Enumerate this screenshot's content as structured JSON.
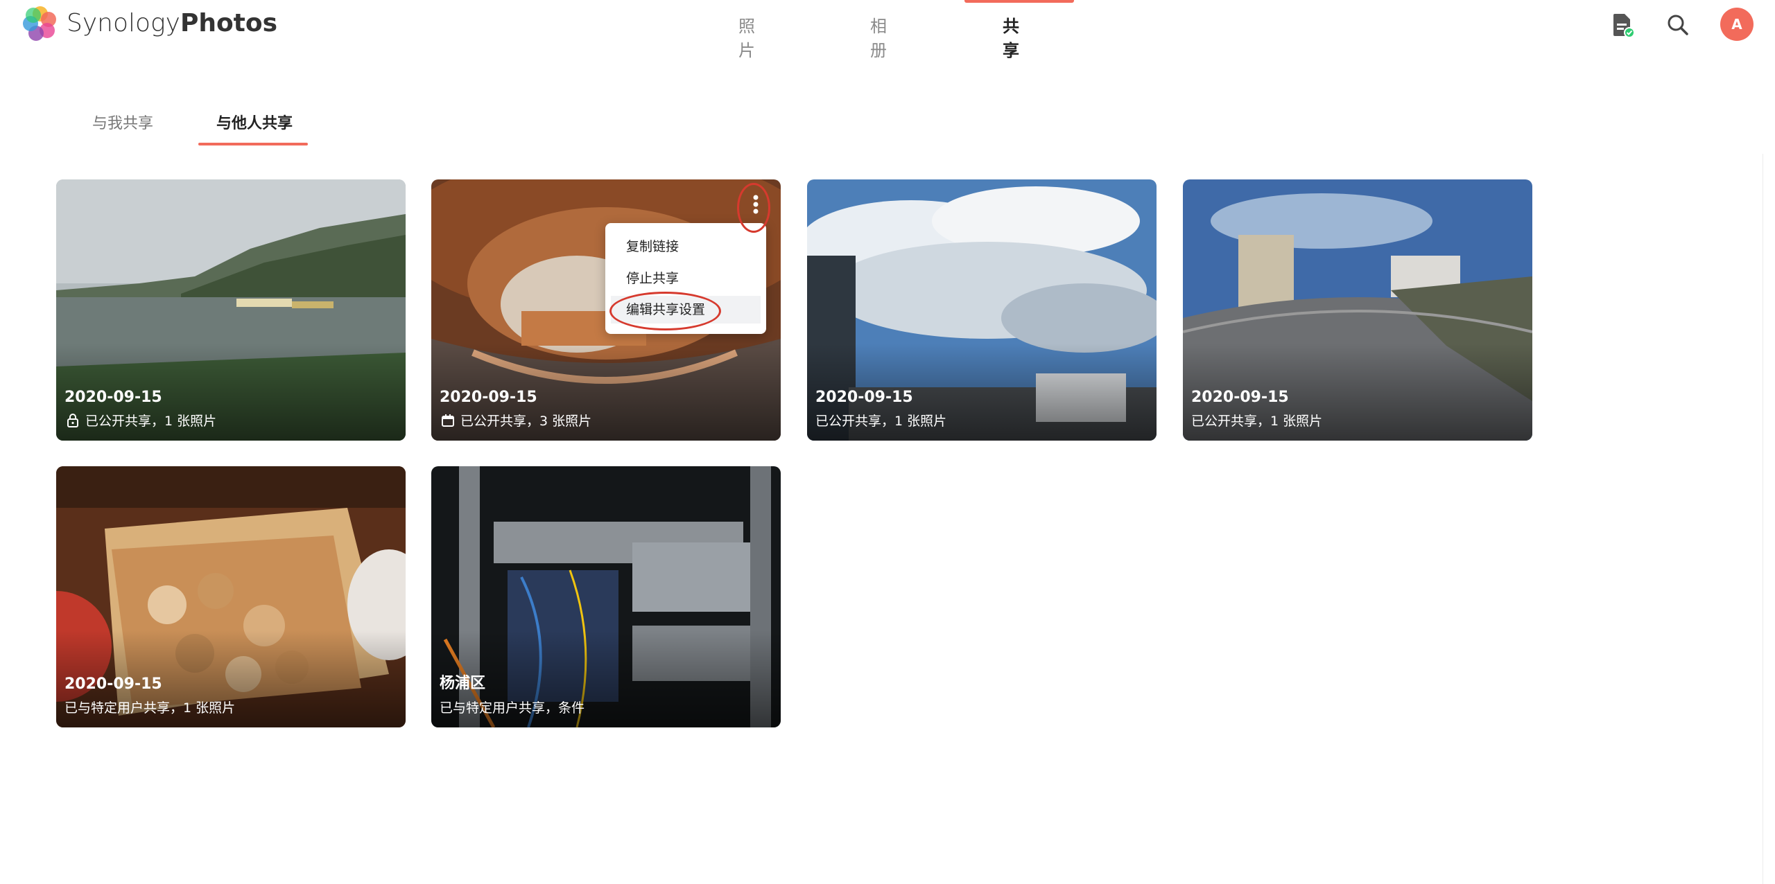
{
  "app": {
    "brand_part1": "Synology",
    "brand_part2": "Photos",
    "avatar_letter": "A",
    "accent": "#f26b5b"
  },
  "nav": {
    "photos": "照片",
    "albums": "相册",
    "sharing": "共享"
  },
  "tabs": {
    "shared_with_me": "与我共享",
    "shared_with_others": "与他人共享"
  },
  "cards": [
    {
      "title": "2020-09-15",
      "subtitle": "已公开共享，1 张照片",
      "sub_icon": "lock-icon"
    },
    {
      "title": "2020-09-15",
      "subtitle": "已公开共享，3 张照片",
      "sub_icon": "calendar-icon"
    },
    {
      "title": "2020-09-15",
      "subtitle": "已公开共享，1 张照片"
    },
    {
      "title": "2020-09-15",
      "subtitle": "已公开共享，1 张照片"
    },
    {
      "title": "2020-09-15",
      "subtitle": "已与特定用户共享，1 张照片"
    },
    {
      "title": "杨浦区",
      "subtitle": "已与特定用户共享，条件"
    }
  ],
  "context_menu": {
    "items": [
      "复制链接",
      "停止共享",
      "编辑共享设置"
    ]
  }
}
